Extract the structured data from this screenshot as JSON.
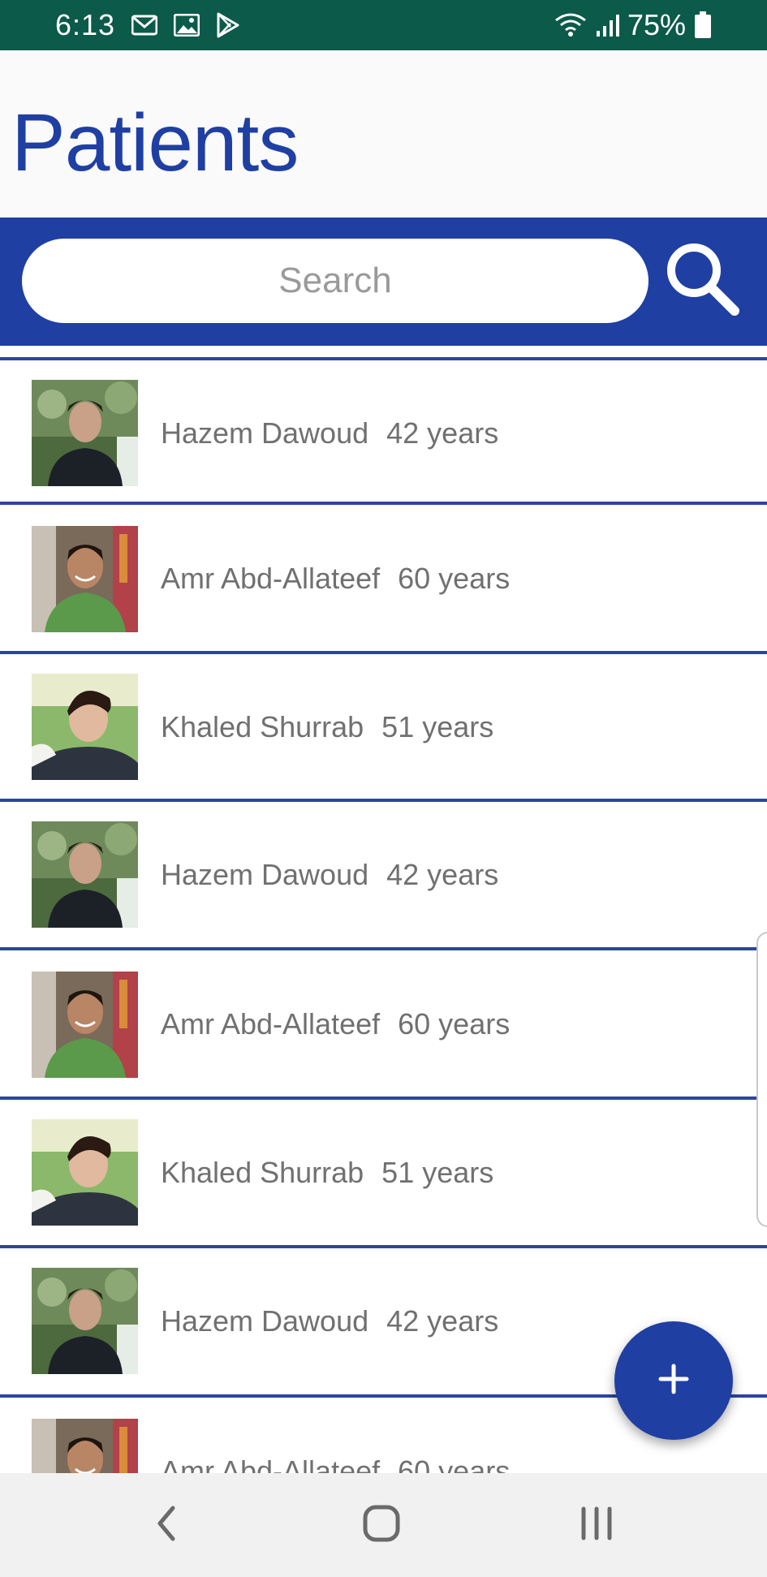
{
  "status_bar": {
    "time": "6:13",
    "battery_percent": "75%",
    "left_icons": [
      "gmail-icon",
      "gallery-icon",
      "play-store-icon"
    ],
    "right_icons": [
      "wifi-icon",
      "signal-icon",
      "battery-icon"
    ]
  },
  "header": {
    "title": "Patients",
    "title_color": "#1f3fa3"
  },
  "search": {
    "placeholder": "Search",
    "icon": "search-icon",
    "bar_color": "#1f3fa3"
  },
  "patients": [
    {
      "name": "Hazem Dawoud",
      "age": "42 years",
      "avatar": "avatar-hazem"
    },
    {
      "name": "Amr Abd-Allateef",
      "age": "60 years",
      "avatar": "avatar-amr"
    },
    {
      "name": "Khaled Shurrab",
      "age": "51 years",
      "avatar": "avatar-khaled"
    },
    {
      "name": "Hazem Dawoud",
      "age": "42 years",
      "avatar": "avatar-hazem"
    },
    {
      "name": "Amr Abd-Allateef",
      "age": "60 years",
      "avatar": "avatar-amr"
    },
    {
      "name": "Khaled Shurrab",
      "age": "51 years",
      "avatar": "avatar-khaled"
    },
    {
      "name": "Hazem Dawoud",
      "age": "42 years",
      "avatar": "avatar-hazem"
    },
    {
      "name": "Amr Abd-Allateef",
      "age": "60 years",
      "avatar": "avatar-amr"
    }
  ],
  "fab": {
    "icon": "plus-icon",
    "color": "#1f3fa3"
  },
  "nav_bar": {
    "buttons": [
      "back-icon",
      "home-icon",
      "recents-icon"
    ]
  },
  "colors": {
    "status_bar": "#0b5a4a",
    "divider": "#2d45a0",
    "text": "#707070"
  }
}
